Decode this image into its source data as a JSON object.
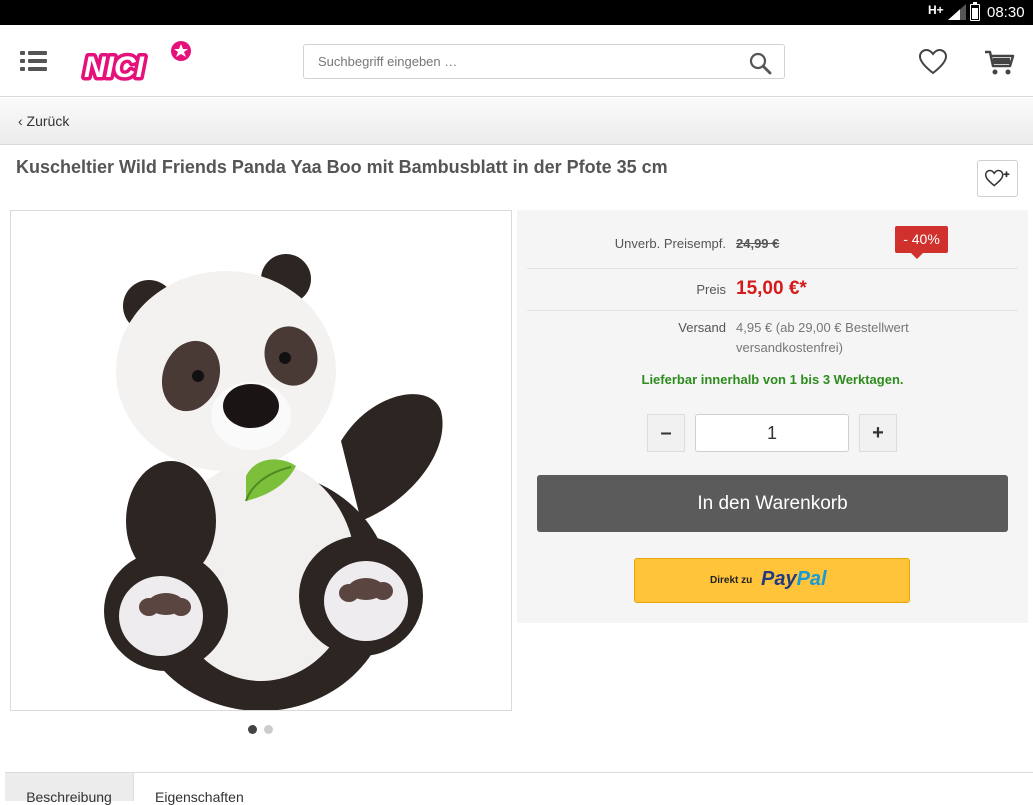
{
  "statusbar": {
    "network": "H+",
    "time": "08:30"
  },
  "header": {
    "logo_text": "NICI",
    "search": {
      "placeholder": "Suchbegriff eingeben …",
      "value": ""
    }
  },
  "nav": {
    "back_label": "‹ Zurück"
  },
  "product": {
    "title": "Kuscheltier Wild Friends Panda Yaa Boo mit Bambusblatt in der Pfote 35 cm",
    "image_pager": {
      "count": 2,
      "active": 1
    }
  },
  "buybox": {
    "rrp_label": "Unverb. Preisempf.",
    "rrp_value": "24,99 €",
    "discount_badge": "- 40%",
    "price_label": "Preis",
    "price_value": "15,00 €*",
    "shipping_label": "Versand",
    "shipping_value": "4,95 € (ab 29,00 € Bestellwert versandkostenfrei)",
    "availability": "Lieferbar innerhalb von 1 bis 3 Werktagen.",
    "quantity": {
      "minus": "–",
      "value": "1",
      "plus": "+"
    },
    "add_to_cart": "In den Warenkorb",
    "paypal": {
      "prefix": "Direkt zu",
      "brand_a": "Pay",
      "brand_b": "Pal"
    }
  },
  "tabs": [
    {
      "label": "Beschreibung",
      "active": true
    },
    {
      "label": "Eigenschaften",
      "active": false
    }
  ],
  "colors": {
    "brand_pink": "#e5107a",
    "price_red": "#d41a1a",
    "availability_green": "#2e8b1e",
    "badge_red": "#d1312d",
    "paypal_yellow": "#ffc439"
  }
}
